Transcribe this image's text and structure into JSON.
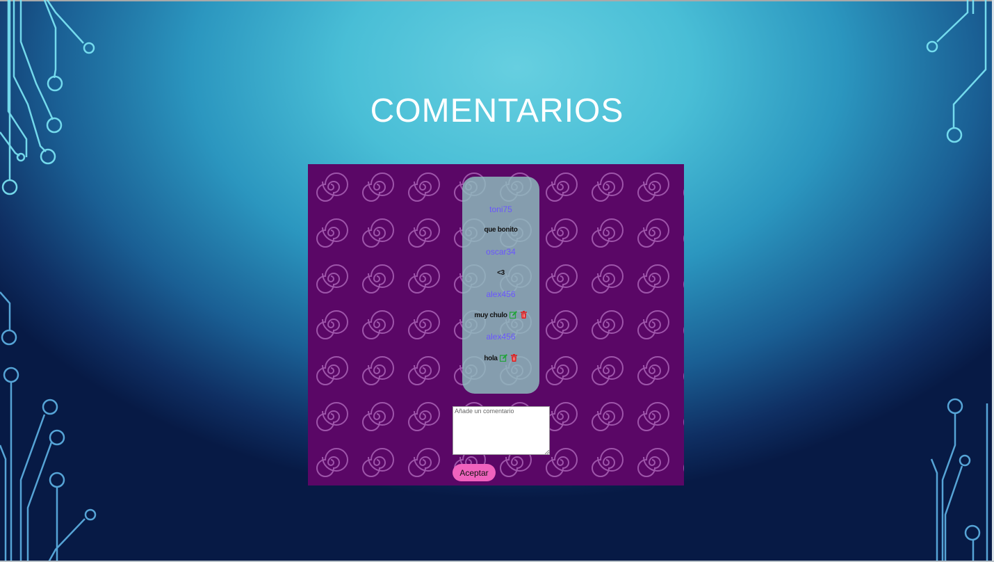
{
  "slide": {
    "title": "COMENTARIOS"
  },
  "comments": [
    {
      "user": "toni75",
      "text": "que bonito",
      "editable": false
    },
    {
      "user": "oscar34",
      "text": "<3",
      "editable": false
    },
    {
      "user": "alex456",
      "text": "muy chulo",
      "editable": true
    },
    {
      "user": "alex456",
      "text": "hola",
      "editable": true
    }
  ],
  "form": {
    "placeholder": "Añade un comentario",
    "submit_label": "Aceptar"
  },
  "icons": {
    "edit": "edit-icon",
    "delete": "trash-icon"
  },
  "colors": {
    "slide_background": "#49bed6",
    "title": "#ffffff",
    "panel_background": "#5a0766",
    "comments_panel": "#8fbebe",
    "username": "#6a55ff",
    "edit_icon": "#22a33a",
    "delete_icon": "#e01f1f",
    "button": "#f062bd"
  }
}
